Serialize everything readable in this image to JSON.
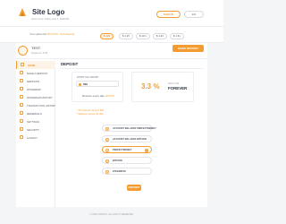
{
  "header": {
    "logo_text": "Site Logo",
    "server_time": "Server time: Friday, june 1, 2018 PM",
    "login_label": "SIGN IN",
    "lang_label": "EN"
  },
  "stats": {
    "referral_label": "Your upline link: ",
    "referral_link": "BITCOIN - New Deposit",
    "pills": [
      {
        "label": "$ 123",
        "active": true
      },
      {
        "label": "$ 1.15"
      },
      {
        "label": "$ 13.1"
      },
      {
        "label": "$ 1.23"
      },
      {
        "label": "$ 1.31"
      }
    ]
  },
  "user": {
    "name": "TEST",
    "id_line": "Registered: 2018",
    "make_deposit_label": "MAKE DEPOSIT"
  },
  "sidebar": {
    "items": [
      {
        "label": "HOME",
        "icon": "home-icon",
        "active": true
      },
      {
        "label": "MAKE A DEPOSIT",
        "icon": "deposit-icon"
      },
      {
        "label": "DEPOSITS",
        "icon": "deposits-icon"
      },
      {
        "label": "WITHDRAW",
        "icon": "withdraw-icon"
      },
      {
        "label": "WITHDRAW HISTORY",
        "icon": "history-icon"
      },
      {
        "label": "TRANSACTION HISTORY",
        "icon": "transactions-icon"
      },
      {
        "label": "REFERRALS",
        "icon": "referrals-icon"
      },
      {
        "label": "SETTINGS",
        "icon": "settings-icon"
      },
      {
        "label": "SECURITY",
        "icon": "security-icon"
      },
      {
        "label": "LOGOUT",
        "icon": "logout-icon"
      }
    ]
  },
  "main": {
    "title": "DEPOSIT",
    "amount_label": "ENTER THE AMOUNT",
    "amount_value": "500",
    "receive_prefix": "Receive every day: ",
    "receive_value": "$16.50",
    "rate_value": "3.3 %",
    "rate_label": "DAILY FOR",
    "rate_period": "FOREVER",
    "notes": [
      "* The minimum amount: $10",
      "* Maximum amount: $1 000"
    ],
    "payment_options": [
      {
        "label": "ACCOUNT BALANCE PERFECTMONEY",
        "selected": false
      },
      {
        "label": "ACCOUNT BALANCE BITCOIN",
        "selected": false
      },
      {
        "label": "PERFECTMONEY",
        "selected": true
      },
      {
        "label": "BITCOIN",
        "selected": false
      },
      {
        "label": "ETHEREUM",
        "selected": false
      }
    ],
    "submit_label": "DEPOSIT"
  },
  "footer": {
    "text": "© 2018 COMPANY. ALL RIGHTS RESERVED."
  },
  "colors": {
    "accent": "#f39c32",
    "text": "#2d3340",
    "background": "#f4f5f7"
  }
}
